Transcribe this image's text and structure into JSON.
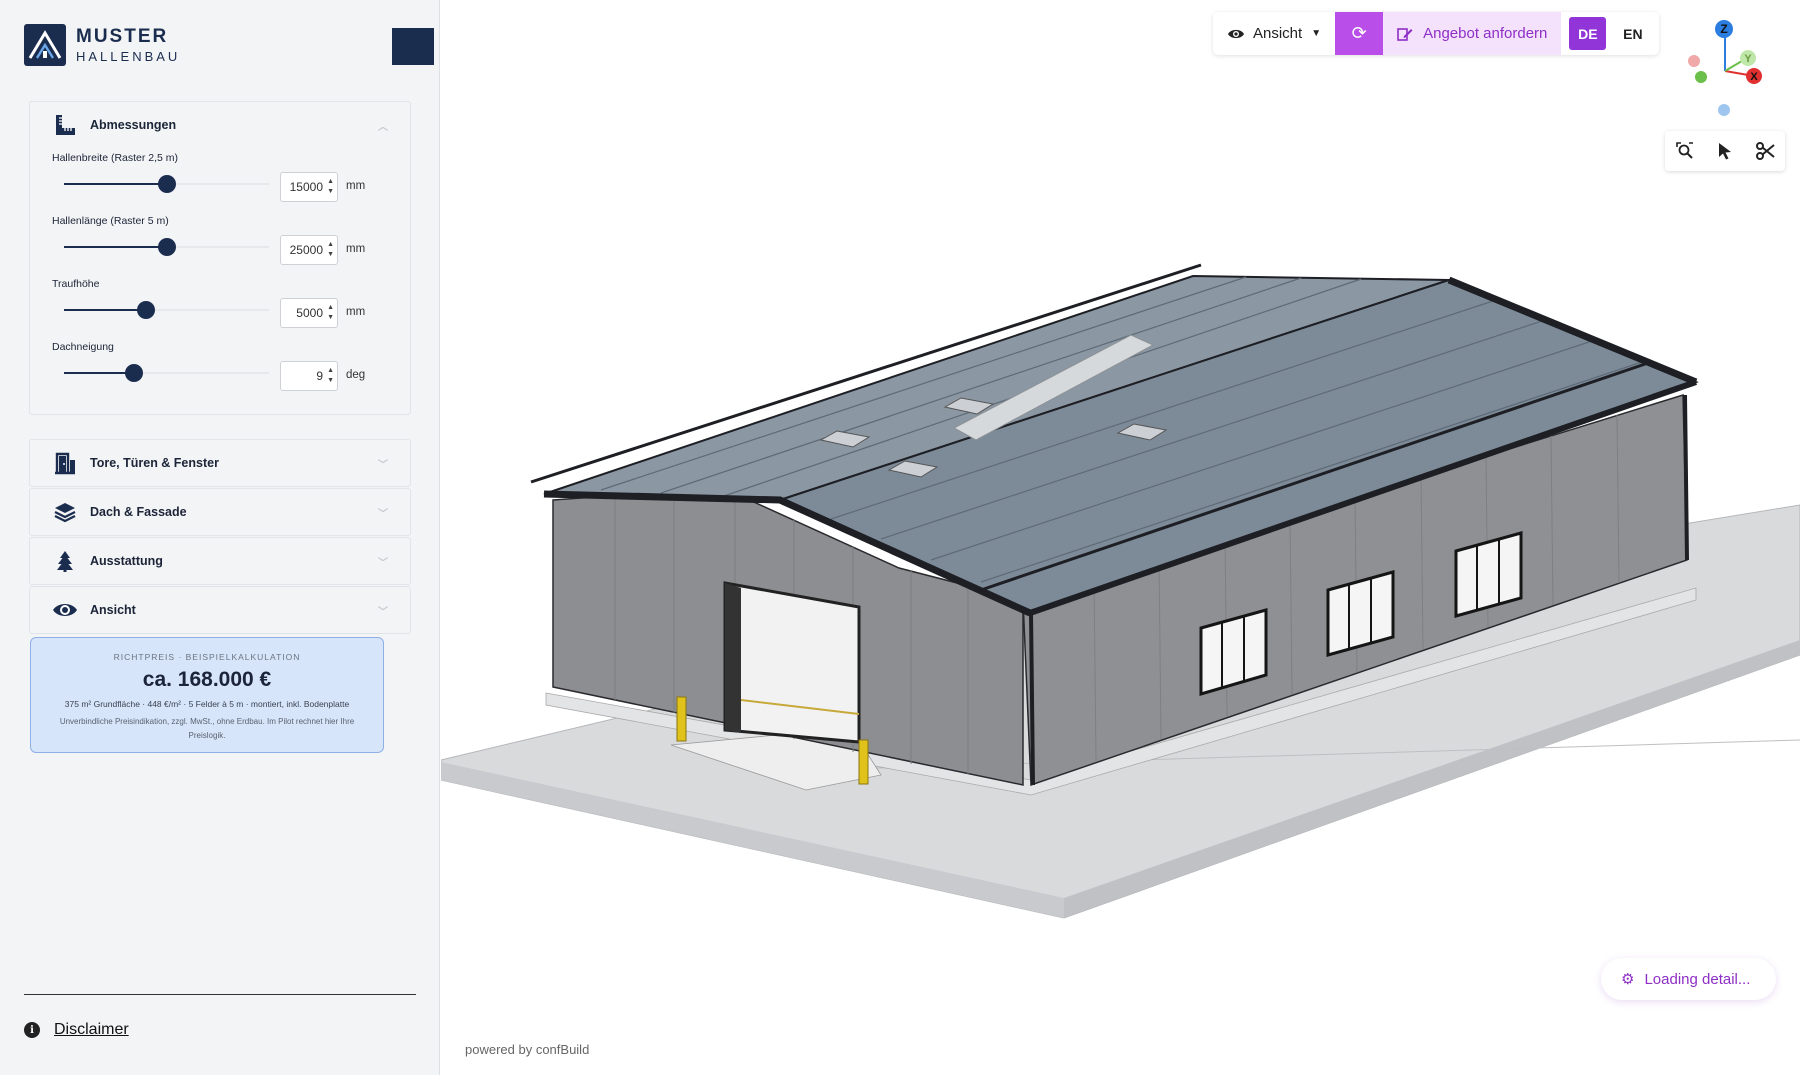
{
  "brand": {
    "name": "MUSTER",
    "subtitle": "HALLENBAU"
  },
  "panels": {
    "dimensions": {
      "title": "Abmessungen",
      "fields": [
        {
          "label": "Hallenbreite (Raster 2,5 m)",
          "value": "15000",
          "unit": "mm",
          "fraction": 0.5
        },
        {
          "label": "Hallenlänge (Raster 5 m)",
          "value": "25000",
          "unit": "mm",
          "fraction": 0.5
        },
        {
          "label": "Traufhöhe",
          "value": "5000",
          "unit": "mm",
          "fraction": 0.4
        },
        {
          "label": "Dachneigung",
          "value": "9",
          "unit": "deg",
          "fraction": 0.34
        }
      ]
    },
    "doors": {
      "title": "Tore, Türen & Fenster"
    },
    "roof": {
      "title": "Dach & Fassade"
    },
    "equipment": {
      "title": "Ausstattung"
    },
    "view": {
      "title": "Ansicht"
    }
  },
  "price": {
    "eyebrow": "RICHTPREIS · BEISPIELKALKULATION",
    "value": "ca. 168.000 €",
    "detail": "375 m² Grundfläche · 448 €/m² · 5 Felder à 5 m · montiert, inkl. Bodenplatte",
    "note": "Unverbindliche Preisindikation, zzgl. MwSt., ohne Erdbau. Im Pilot rechnet hier Ihre Preislogik."
  },
  "footer": {
    "disclaimer": "Disclaimer",
    "powered": "powered by confBuild"
  },
  "toolbar": {
    "view_label": "Ansicht",
    "offer_label": "Angebot anfordern",
    "lang_de": "DE",
    "lang_en": "EN"
  },
  "gizmo": {
    "z": "Z",
    "y": "Y",
    "x": "X"
  },
  "loading": "Loading detail...",
  "icons": {
    "view": "eye-icon",
    "refresh": "refresh-icon",
    "offer": "edit-icon",
    "tools": [
      "zoom-fit-icon",
      "pointer-icon",
      "scissors-icon"
    ],
    "settings": "gear-icon"
  },
  "colors": {
    "brand": "#1b2d4f",
    "accent": "#b94ee8",
    "accent_light": "#f4e2fc",
    "price_bg": "#d7e5fa"
  }
}
